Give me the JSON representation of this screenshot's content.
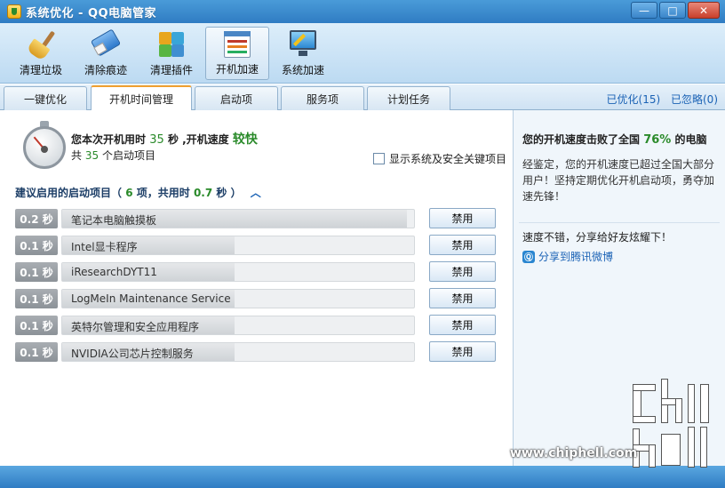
{
  "window": {
    "title": "系统优化 - QQ电脑管家"
  },
  "toolbar": {
    "items": [
      {
        "label": "清理垃圾",
        "icon": "broom-icon"
      },
      {
        "label": "清除痕迹",
        "icon": "eraser-icon"
      },
      {
        "label": "清理插件",
        "icon": "puzzle-icon"
      },
      {
        "label": "开机加速",
        "icon": "boot-speed-icon",
        "active": true
      },
      {
        "label": "系统加速",
        "icon": "monitor-icon"
      }
    ]
  },
  "tabs": {
    "items": [
      {
        "label": "一键优化"
      },
      {
        "label": "开机时间管理",
        "active": true
      },
      {
        "label": "启动项"
      },
      {
        "label": "服务项"
      },
      {
        "label": "计划任务"
      }
    ],
    "optimized": "已优化(15)",
    "ignored": "已忽略(0)"
  },
  "summary": {
    "prefix": "您本次开机用时",
    "seconds": "35",
    "mid": "秒 ,开机速度",
    "speed": "较快",
    "line2_prefix": "共",
    "item_count": "35",
    "line2_suffix": "个启动项目"
  },
  "show_system_label": "显示系统及安全关键项目",
  "section": {
    "prefix": "建议启用的启动项目（",
    "count": "6",
    "mid": "项，共用时",
    "total": "0.7",
    "suffix": "秒 ）"
  },
  "startup_items": [
    {
      "time": "0.2 秒",
      "name": "笔记本电脑触摸板",
      "fill": 0.98
    },
    {
      "time": "0.1 秒",
      "name": "Intel显卡程序",
      "fill": 0.49
    },
    {
      "time": "0.1 秒",
      "name": "iResearchDYT11",
      "fill": 0.49
    },
    {
      "time": "0.1 秒",
      "name": "LogMeIn Maintenance Service",
      "fill": 0.49
    },
    {
      "time": "0.1 秒",
      "name": "英特尔管理和安全应用程序",
      "fill": 0.49
    },
    {
      "time": "0.1 秒",
      "name": "NVIDIA公司芯片控制服务",
      "fill": 0.49
    }
  ],
  "disable_label": "禁用",
  "right_panel": {
    "title_prefix": "您的开机速度击败了全国",
    "percent": "76%",
    "title_suffix": "的电脑",
    "desc": "经鉴定，您的开机速度已超过全国大部分用户！坚持定期优化开机启动项，勇夺加速先锋！",
    "share_text": "速度不错，分享给好友炫耀下！",
    "weibo_link": "分享到腾讯微博"
  },
  "watermark": {
    "text": "www.chiphell.com"
  },
  "colors": {
    "accent_green": "#2a8a2a",
    "link_blue": "#1a62b5",
    "title_blue": "#2f7cc3"
  }
}
